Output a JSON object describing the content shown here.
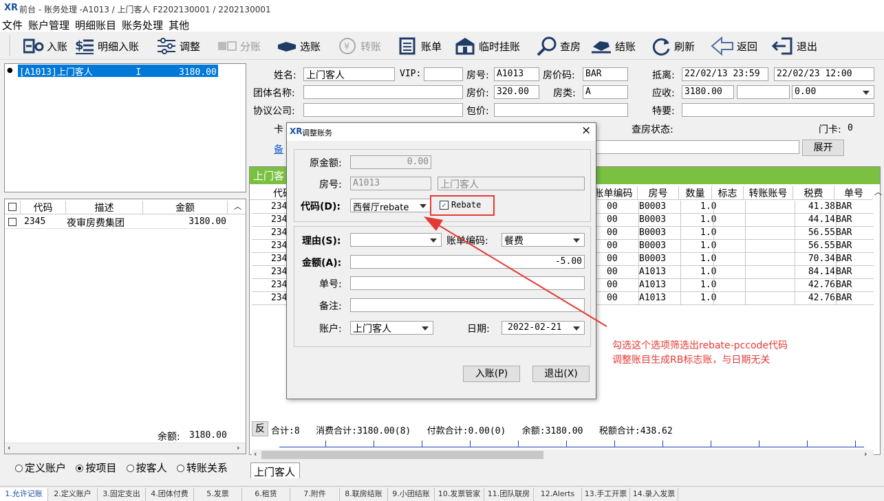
{
  "window": {
    "title": "前台 - 账务处理 -A1013  /  上门客人  F2202130001  /  2202130001",
    "logo": "XR"
  },
  "menu": [
    "文件",
    "账户管理",
    "明细账目",
    "账务处理",
    "其他"
  ],
  "toolbar": [
    {
      "label": "入账",
      "icon": "post-icon",
      "enabled": true
    },
    {
      "label": "明细入账",
      "icon": "detail-post-icon",
      "enabled": true
    },
    {
      "label": "调整",
      "icon": "adjust-icon",
      "enabled": true
    },
    {
      "label": "分账",
      "icon": "split-icon",
      "enabled": false
    },
    {
      "label": "选账",
      "icon": "select-icon",
      "enabled": true
    },
    {
      "label": "转账",
      "icon": "transfer-icon",
      "enabled": false
    },
    {
      "label": "账单",
      "icon": "bill-icon",
      "enabled": true
    },
    {
      "label": "临时挂账",
      "icon": "temp-charge-icon",
      "enabled": true
    },
    {
      "label": "查房",
      "icon": "check-room-icon",
      "enabled": true
    },
    {
      "label": "结账",
      "icon": "checkout-icon",
      "enabled": true
    },
    {
      "label": "刷新",
      "icon": "refresh-icon",
      "enabled": true
    },
    {
      "label": "返回",
      "icon": "back-icon",
      "enabled": true
    },
    {
      "label": "退出",
      "icon": "exit-icon",
      "enabled": true
    }
  ],
  "tree": {
    "item": "[A1013]上门客人        I       3180.00"
  },
  "left_grid": {
    "headers": [
      "代码",
      "描述",
      "金额"
    ],
    "rows": [
      {
        "code": "2345",
        "desc": "夜审房费集团",
        "amount": "3180.00"
      }
    ],
    "balance_label": "余额:",
    "balance_value": "3180.00"
  },
  "left_radios": [
    {
      "label": "定义账户",
      "checked": false
    },
    {
      "label": "按项目",
      "checked": true
    },
    {
      "label": "按客人",
      "checked": false
    },
    {
      "label": "转账关系",
      "checked": false
    }
  ],
  "guest": {
    "name_label": "姓名:",
    "name": "上门客人",
    "vip_label": "VIP:",
    "vip": "",
    "room_label": "房号:",
    "room": "A1013",
    "ratecode_label": "房价码:",
    "ratecode": "BAR",
    "arrival_label": "抵离:",
    "arrival": "22/02/13 23:59",
    "departure": "22/02/23 12:00",
    "group_label": "团体名称:",
    "group": "",
    "rate_label": "房价:",
    "rate": "320.00",
    "roomtype_label": "房类:",
    "roomtype": "A",
    "receivable_label": "应收:",
    "receivable": "3180.00",
    "receivable2": "",
    "receivable3": "0.00",
    "company_label": "协议公司:",
    "company": "",
    "package_label": "包价:",
    "package": "",
    "special_label": "特要:",
    "special": "",
    "card_label": "卡",
    "checkstatus_label": "查房状态:",
    "doorcard_label": "门卡:",
    "doorcard": "0",
    "remark_label": "备",
    "expand_btn": "展开"
  },
  "right_grid": {
    "title": "上门客",
    "headers": [
      "代码",
      "账单编码",
      "房号",
      "数量",
      "标志",
      "转账账号",
      "税费",
      "单号"
    ],
    "rows": [
      {
        "code": "234",
        "bill": "00",
        "room": "B0003",
        "qty": "1.0",
        "tax": "41.38",
        "no": "BAR"
      },
      {
        "code": "234",
        "bill": "00",
        "room": "B0003",
        "qty": "1.0",
        "tax": "44.14",
        "no": "BAR"
      },
      {
        "code": "234",
        "bill": "00",
        "room": "B0003",
        "qty": "1.0",
        "tax": "56.55",
        "no": "BAR"
      },
      {
        "code": "234",
        "bill": "00",
        "room": "B0003",
        "qty": "1.0",
        "tax": "56.55",
        "no": "BAR"
      },
      {
        "code": "234",
        "bill": "00",
        "room": "B0003",
        "qty": "1.0",
        "tax": "70.34",
        "no": "BAR"
      },
      {
        "code": "234",
        "bill": "00",
        "room": "A1013",
        "qty": "1.0",
        "tax": "84.14",
        "no": "BAR"
      },
      {
        "code": "234",
        "bill": "00",
        "room": "A1013",
        "qty": "1.0",
        "tax": "42.76",
        "no": "BAR"
      },
      {
        "code": "234",
        "bill": "00",
        "room": "A1013",
        "qty": "1.0",
        "tax": "42.76",
        "no": "BAR"
      }
    ],
    "footer_btn": "反",
    "footer": "合计:8   消费合计:3180.00(8)   付款合计:0.00(0)   余额:3180.00   税额合计:438.62",
    "bottom_tab": "上门客人"
  },
  "dialog": {
    "title": "调整账务",
    "orig_label": "原金额:",
    "orig": "0.00",
    "room_label": "房号:",
    "room": "A1013",
    "guest": "上门客人",
    "code_label": "代码(D):",
    "code": "西餐厅rebate",
    "rebate_label": "Rebate",
    "rebate_checked": true,
    "reason_label": "理由(S):",
    "reason": "",
    "billcode_label": "账单编码:",
    "billcode": "餐费",
    "amount_label": "金额(A):",
    "amount": "-5.00",
    "docno_label": "单号:",
    "docno": "",
    "remark_label": "备注:",
    "remark": "",
    "account_label": "账户:",
    "account": "上门客人",
    "date_label": "日期:",
    "date": "2022-02-21",
    "post_btn": "入账(P)",
    "exit_btn": "退出(X)"
  },
  "annotation": {
    "line1": "勾选这个选项筛选出rebate-pccode代码",
    "line2": "调整账目生成RB标志账，与日期无关",
    "color": "#e53935"
  },
  "bottom_tabs": [
    "1.允许记账",
    "2.定义账户",
    "3.固定支出",
    "4.团体付费",
    "5.发票",
    "6.租赁",
    "7.附件",
    "8.联房结账",
    "9.小团结账",
    "10.发票管家",
    "11.团队联房",
    "12.Alerts",
    "13.手工开票",
    "14.录入发票"
  ]
}
